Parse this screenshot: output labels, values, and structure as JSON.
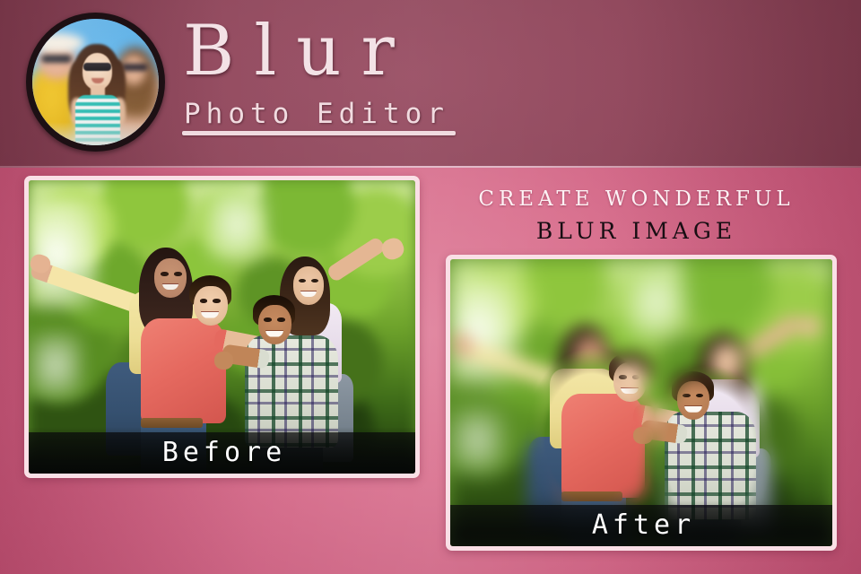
{
  "app": {
    "title": "Blur",
    "subtitle": "Photo Editor",
    "theme": {
      "header_bg": "#8e4459",
      "body_bg": "#d4607f",
      "frame_border": "#fadfe6",
      "title_color": "#f3e2e6",
      "tagline_light": "#fdf1f4",
      "tagline_dark": "#180e13",
      "caption_color": "#ffffff"
    }
  },
  "logo": {
    "icon_name": "app-logo-avatar",
    "description": "circular photo of a woman in a teal and white striped tank top with sunglasses, blurred friends on both sides against a blue sky"
  },
  "tagline": {
    "line1": "CREATE WONDERFUL",
    "line2": "BLUR IMAGE"
  },
  "photos": [
    {
      "id": "before",
      "caption": "Before",
      "description": "four friends piggybacking in a park, everything in focus"
    },
    {
      "id": "after",
      "caption": "After",
      "description": "same photo with background and two people blurred, the two front boys kept sharp"
    }
  ]
}
